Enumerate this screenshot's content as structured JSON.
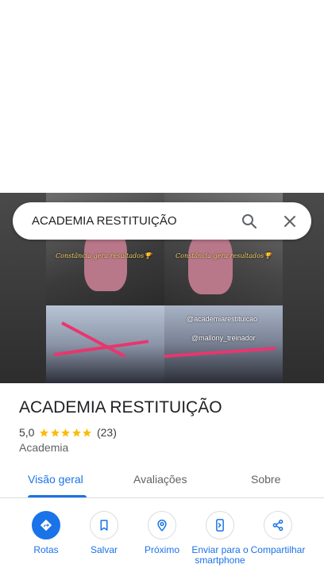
{
  "search": {
    "query": "ACADEMIA RESTITUIÇÃO"
  },
  "photo": {
    "caption_left": "Constância gera resultados🏆",
    "caption_right": "Constância gera resultados🏆",
    "handle_1": "@academiarestituicao",
    "handle_2": "@mallony_treinador"
  },
  "place": {
    "name": "ACADEMIA RESTITUIÇÃO",
    "rating": "5,0",
    "stars": 5,
    "reviews_count": "(23)",
    "category": "Academia"
  },
  "tabs": [
    {
      "label": "Visão geral",
      "active": true
    },
    {
      "label": "Avaliações",
      "active": false
    },
    {
      "label": "Sobre",
      "active": false
    }
  ],
  "actions": [
    {
      "label": "Rotas",
      "icon": "directions-icon"
    },
    {
      "label": "Salvar",
      "icon": "bookmark-icon"
    },
    {
      "label": "Próximo",
      "icon": "nearby-icon"
    },
    {
      "label": "Enviar para o smartphone",
      "icon": "send-to-phone-icon"
    },
    {
      "label": "Compartilhar",
      "icon": "share-icon"
    }
  ],
  "colors": {
    "accent": "#1a73e8",
    "star": "#fbbc04",
    "text": "#202124",
    "muted": "#5f6368"
  }
}
